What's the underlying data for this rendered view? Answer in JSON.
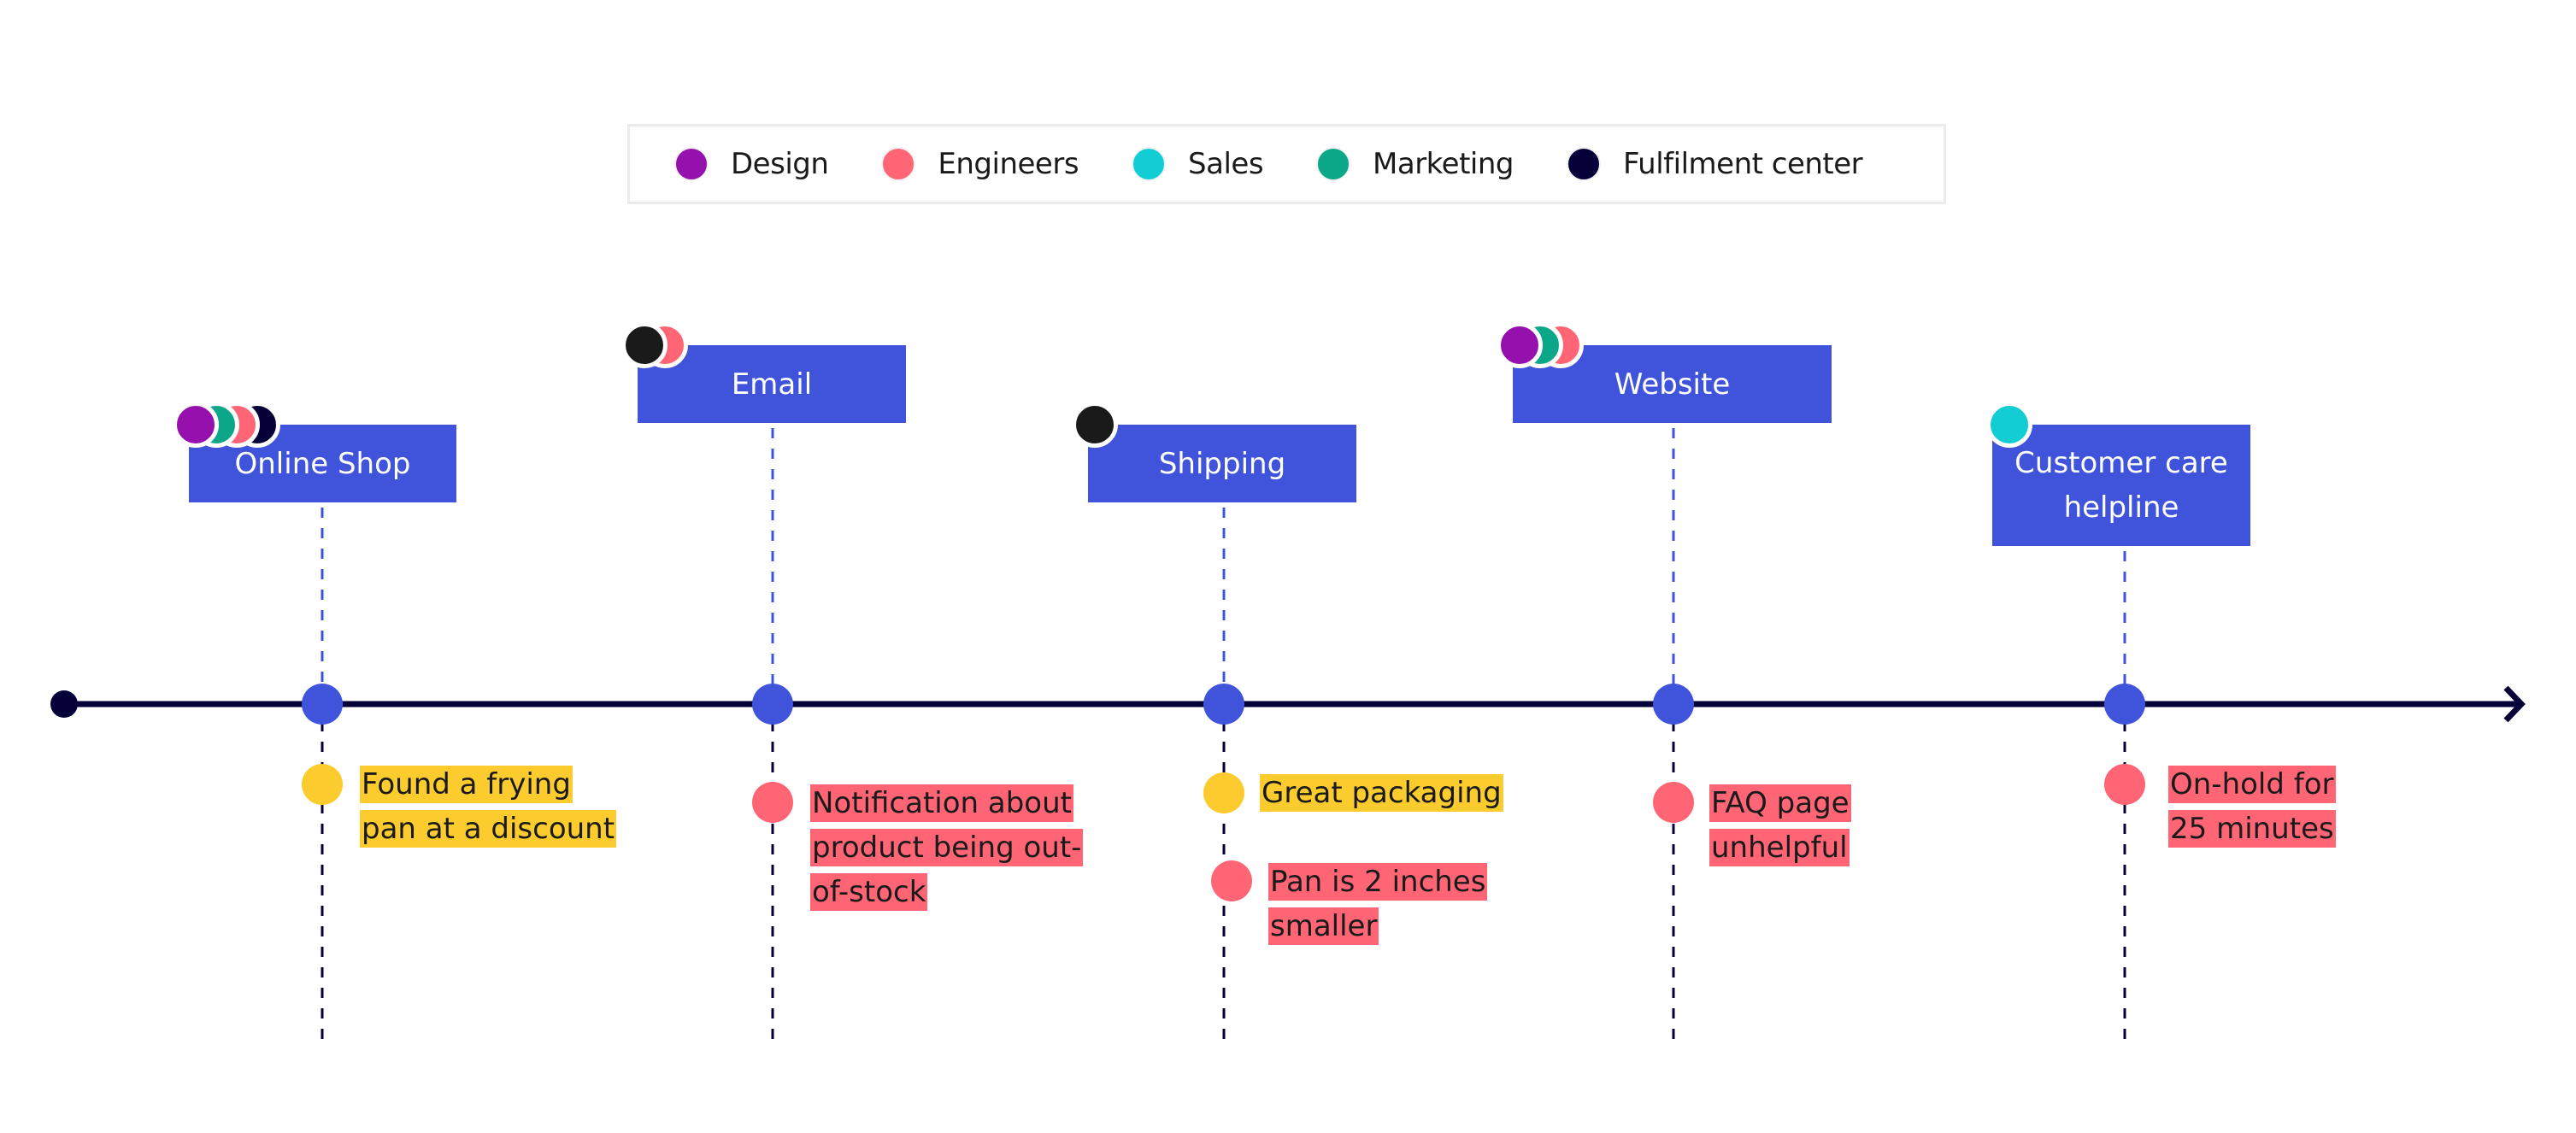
{
  "legend": {
    "items": [
      {
        "label": "Design",
        "color": "#9510ac"
      },
      {
        "label": "Engineers",
        "color": "#ff6575"
      },
      {
        "label": "Sales",
        "color": "#12cdd4"
      },
      {
        "label": "Marketing",
        "color": "#0ca789"
      },
      {
        "label": "Fulfilment center",
        "color": "#050038"
      }
    ]
  },
  "colors": {
    "timeline": "#050038",
    "touchpoint_fill": "#3f54da",
    "connector_up": "#3f54da",
    "connector_down": "#050038",
    "positive": "#fccc2f",
    "negative": "#ff6575",
    "neutral_black": "#1a1a1a"
  },
  "timeline": {
    "stages": [
      {
        "touchpoint": "Online Shop",
        "teams": [
          "Design",
          "Marketing",
          "Engineers",
          "Fulfilment center"
        ],
        "notes": [
          {
            "text": "Found a frying pan at a discount",
            "lines": [
              "Found a frying",
              "pan at a discount"
            ],
            "sentiment": "positive"
          }
        ]
      },
      {
        "touchpoint": "Email",
        "teams": [
          "Black",
          "Engineers"
        ],
        "notes": [
          {
            "text": "Notification about product being out-of-stock",
            "lines": [
              "Notification about",
              "product being out-",
              "of-stock"
            ],
            "sentiment": "negative"
          }
        ]
      },
      {
        "touchpoint": "Shipping",
        "teams": [
          "Black"
        ],
        "notes": [
          {
            "text": "Great packaging",
            "lines": [
              "Great packaging"
            ],
            "sentiment": "positive"
          },
          {
            "text": "Pan is 2 inches smaller",
            "lines": [
              "Pan is 2 inches",
              "smaller"
            ],
            "sentiment": "negative"
          }
        ]
      },
      {
        "touchpoint": "Website",
        "teams": [
          "Design",
          "Marketing",
          "Engineers"
        ],
        "notes": [
          {
            "text": "FAQ page unhelpful",
            "lines": [
              "FAQ page",
              "unhelpful"
            ],
            "sentiment": "negative"
          }
        ]
      },
      {
        "touchpoint": "Customer care helpline",
        "touchpoint_lines": [
          "Customer care",
          "helpline"
        ],
        "teams": [
          "Sales"
        ],
        "notes": [
          {
            "text": "On-hold for 25 minutes",
            "lines": [
              "On-hold for",
              "25 minutes"
            ],
            "sentiment": "negative"
          }
        ]
      }
    ]
  }
}
